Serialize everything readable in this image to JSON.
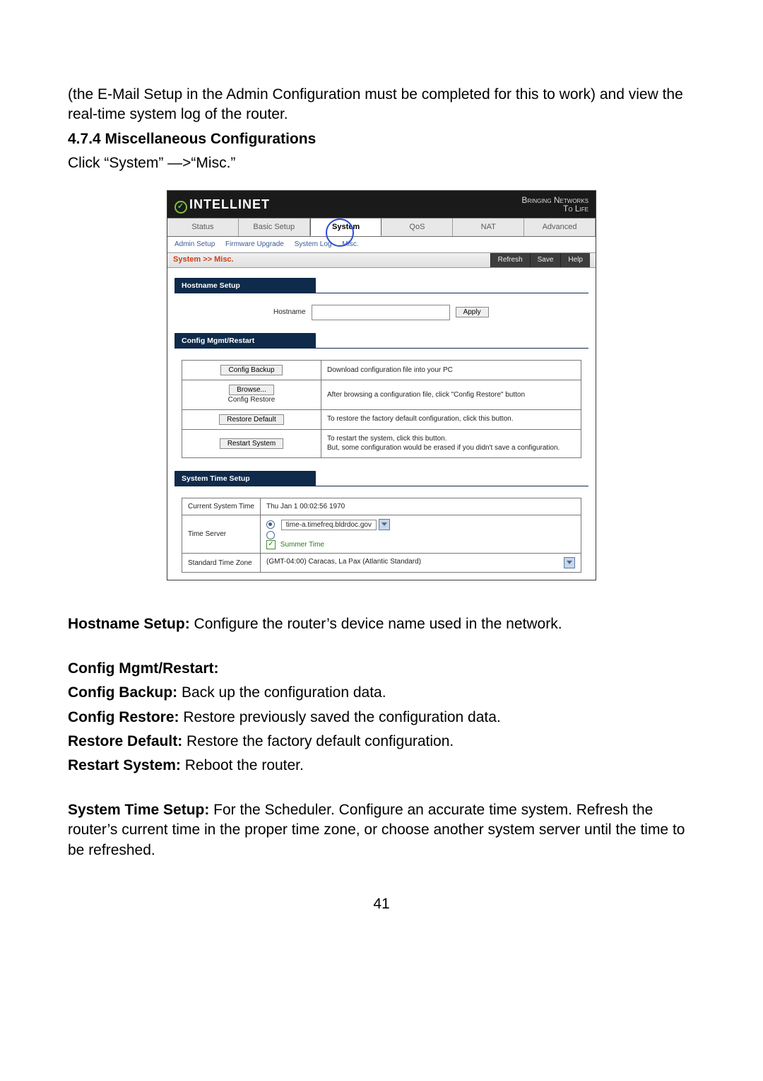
{
  "intro": "(the E-Mail Setup in the Admin Configuration must be completed for this to work) and view the real-time system log of the router.",
  "section_title": "4.7.4 Miscellaneous Configurations",
  "click_line": "Click “System” —>“Misc.”",
  "ss": {
    "brand": "INTELLINET",
    "tagline_top": "Bringing Networks",
    "tagline_bot": "To Life",
    "tabs": [
      "Status",
      "Basic Setup",
      "System",
      "QoS",
      "NAT",
      "Advanced"
    ],
    "subnav": [
      "Admin Setup",
      "Firmware Upgrade",
      "System Log",
      "Misc."
    ],
    "crumb": "System >> Misc.",
    "actions": [
      "Refresh",
      "Save",
      "Help"
    ],
    "panel_hostname": "Hostname Setup",
    "hostname_label": "Hostname",
    "apply": "Apply",
    "panel_config": "Config Mgmt/Restart",
    "cfg": {
      "backup_btn": "Config Backup",
      "backup_txt": "Download configuration file into your PC",
      "browse_btn": "Browse...",
      "restore_lbl": "Config Restore",
      "restore_txt": "After browsing a configuration file, click \"Config Restore\" button",
      "default_btn": "Restore Default",
      "default_txt": "To restore the factory default configuration, click this button.",
      "restart_btn": "Restart System",
      "restart_txt": "To restart the system, click this button.\nBut, some configuration would be erased if you didn't save a configuration."
    },
    "panel_time": "System Time Setup",
    "time": {
      "cur_lbl": "Current System Time",
      "cur_val": "Thu Jan 1 00:02:56 1970",
      "srv_lbl": "Time Server",
      "srv_val": "time-a.timefreq.bldrdoc.gov",
      "summer": "Summer Time",
      "tz_lbl": "Standard Time Zone",
      "tz_val": "(GMT-04:00) Caracas, La Pax (Atlantic Standard)"
    }
  },
  "desc": {
    "hostname_k": "Hostname Setup:",
    "hostname_v": " Configure the router’s device name used in the network.",
    "cfg_head": "Config Mgmt/Restart:",
    "backup_k": "Config Backup:",
    "backup_v": " Back up the configuration data.",
    "restore_k": "Config Restore:",
    "restore_v": " Restore previously saved the configuration data.",
    "default_k": "Restore Default:",
    "default_v": " Restore the factory default configuration.",
    "restart_k": "Restart System:",
    "restart_v": " Reboot the router.",
    "time_k": "System Time Setup:",
    "time_v": " For the Scheduler. Configure an accurate time system. Refresh the router’s current time in the proper time zone, or choose another system server until the time to be refreshed."
  },
  "pagenum": "41"
}
